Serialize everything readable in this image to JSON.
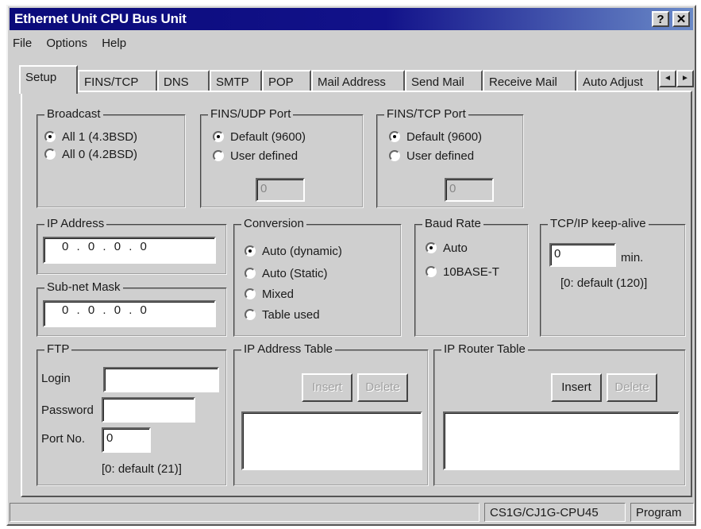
{
  "window": {
    "title": "Ethernet Unit CPU Bus Unit",
    "help_glyph": "?",
    "close_glyph": "✕"
  },
  "menubar": {
    "file": "File",
    "options": "Options",
    "help": "Help"
  },
  "tabs": [
    {
      "label": "Setup",
      "active": true
    },
    {
      "label": "FINS/TCP"
    },
    {
      "label": "DNS"
    },
    {
      "label": "SMTP"
    },
    {
      "label": "POP"
    },
    {
      "label": "Mail Address"
    },
    {
      "label": "Send Mail"
    },
    {
      "label": "Receive Mail"
    },
    {
      "label": "Auto Adjust"
    }
  ],
  "tab_scroll": {
    "left": "◄",
    "right": "►"
  },
  "broadcast": {
    "title": "Broadcast",
    "options": [
      "All 1 (4.3BSD)",
      "All 0 (4.2BSD)"
    ],
    "selected": 0
  },
  "fins_udp_port": {
    "title": "FINS/UDP Port",
    "options": [
      "Default (9600)",
      "User defined"
    ],
    "selected": 0,
    "value": "0"
  },
  "fins_tcp_port": {
    "title": "FINS/TCP Port",
    "options": [
      "Default (9600)",
      "User defined"
    ],
    "selected": 0,
    "value": "0"
  },
  "ip_address": {
    "title": "IP Address",
    "value": "0 . 0 . 0 . 0"
  },
  "subnet_mask": {
    "title": "Sub-net Mask",
    "value": "0 . 0 . 0 . 0"
  },
  "conversion": {
    "title": "Conversion",
    "options": [
      "Auto (dynamic)",
      "Auto (Static)",
      "Mixed",
      "Table used"
    ],
    "selected": 0
  },
  "baud_rate": {
    "title": "Baud Rate",
    "options": [
      "Auto",
      "10BASE-T"
    ],
    "selected": 0
  },
  "keep_alive": {
    "title": "TCP/IP keep-alive",
    "value": "0",
    "unit": "min.",
    "hint": "[0: default (120)]"
  },
  "ftp": {
    "title": "FTP",
    "login_label": "Login",
    "login_value": "",
    "password_label": "Password",
    "password_value": "",
    "port_label": "Port No.",
    "port_value": "0",
    "hint": "[0: default (21)]"
  },
  "ip_address_table": {
    "title": "IP Address Table",
    "insert_label": "Insert",
    "delete_label": "Delete"
  },
  "ip_router_table": {
    "title": "IP Router Table",
    "insert_label": "Insert",
    "delete_label": "Delete"
  },
  "statusbar": {
    "model": "CS1G/CJ1G-CPU45",
    "mode": "Program"
  }
}
